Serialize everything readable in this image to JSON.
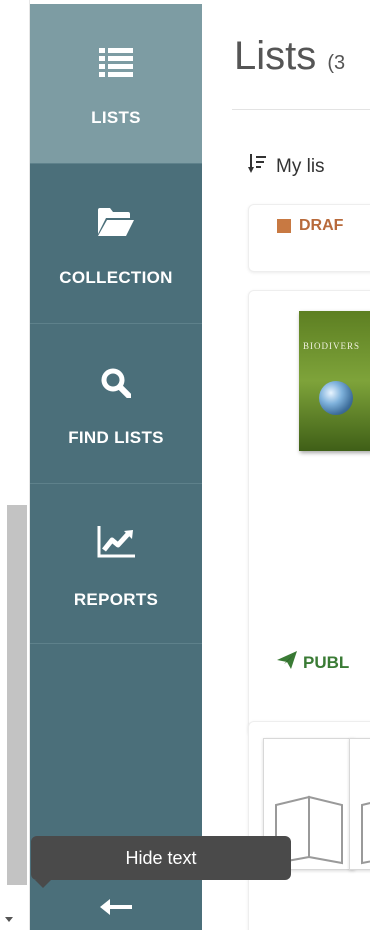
{
  "sidebar": {
    "items": [
      {
        "label": "LISTS",
        "icon": "list-icon",
        "active": true
      },
      {
        "label": "COLLECTION",
        "icon": "folder-open-icon",
        "active": false
      },
      {
        "label": "FIND LISTS",
        "icon": "search-icon",
        "active": false
      },
      {
        "label": "REPORTS",
        "icon": "line-chart-icon",
        "active": false
      }
    ],
    "hide_text_tooltip": "Hide text",
    "collapse_icon": "arrow-left-icon"
  },
  "main": {
    "title": "Lists",
    "title_count": "(3",
    "sort_label": "My lis",
    "sort_icon": "sort-icon",
    "cards": [
      {
        "status": "DRAF",
        "status_color": "#c87942"
      },
      {
        "book_cover_title": "BIODIVERS",
        "status": "PUBL",
        "status_icon": "paper-plane-icon",
        "status_color": "#3a7b35"
      },
      {
        "thumbnails": [
          "book-placeholder-icon",
          "book-placeholder-icon"
        ]
      }
    ]
  },
  "colors": {
    "sidebar_bg": "#4b6f7a",
    "sidebar_active_bg": "#7d9ca3",
    "tooltip_bg": "#4a4a4a"
  }
}
